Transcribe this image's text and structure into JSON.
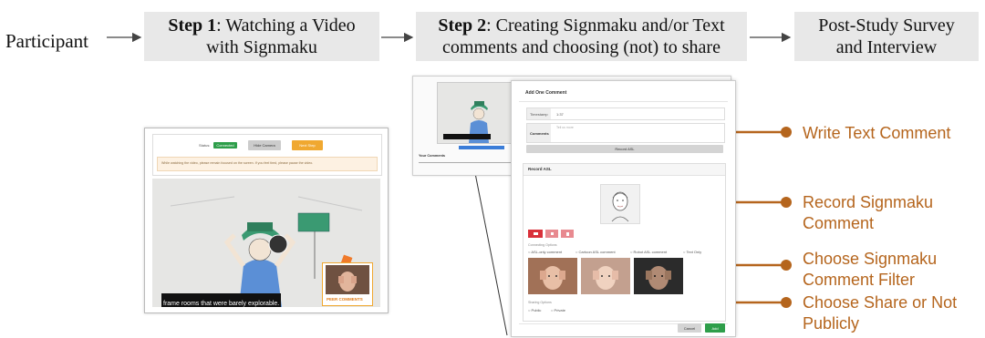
{
  "flow": {
    "participant": "Participant",
    "step1": {
      "bold": "Step 1",
      "rest1": ": Watching a Video",
      "line2": "with Signmaku"
    },
    "step2": {
      "bold": "Step 2",
      "rest1": ": Creating Signmaku and/or Text",
      "line2": "comments and choosing (not) to share"
    },
    "post": {
      "line1": "Post-Study Survey",
      "line2": "and Interview"
    }
  },
  "annotations": {
    "write_text": "Write Text Comment",
    "record_line1": "Record Signmaku",
    "record_line2": "Comment",
    "filter_line1": "Choose Signmaku",
    "filter_line2": "Comment Filter",
    "share_line1": "Choose Share or Not",
    "share_line2": "Publicly"
  },
  "video_page": {
    "status_label": "Status:",
    "status_value": "Connected",
    "hide_camera": "Hide Camera",
    "next_step": "Next Step",
    "notice": "While watching the video, please remain focused on the screen. If you feel tired, please pause the video.",
    "caption": "frame rooms that were barely explorable.",
    "peer_comments": "PEER COMMENTS"
  },
  "comment_form": {
    "title": "Add One Comment",
    "timestamp_label": "Timestamp",
    "timestamp_value": "1:37",
    "comments_label": "Comments",
    "comments_placeholder": "Tell us more",
    "record_button": "Record ASL",
    "record_section": "Record ASL",
    "connecting_options": "Connecting Options",
    "options": [
      "ASL-only comment",
      "Cartoon ASL comment",
      "Robot ASL comment",
      "Text Only"
    ],
    "sharing_options": "Sharing Options",
    "public": "Public",
    "private": "Private",
    "cancel": "Cancel",
    "add": "Add",
    "your_comments": "Your Comments"
  },
  "colors": {
    "annotation": "#b5651d",
    "box": "#e8e8e8",
    "connected": "#2e9e4a",
    "next_step": "#f0a830",
    "record_red": "#d9303a"
  }
}
